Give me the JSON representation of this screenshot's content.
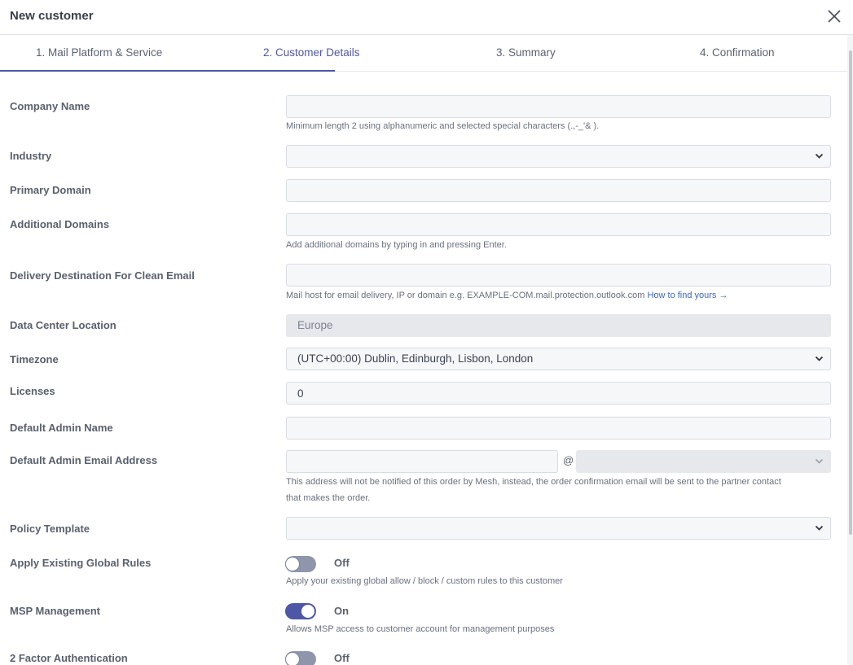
{
  "dialog": {
    "title": "New customer",
    "close_icon": "close-icon"
  },
  "tabs": [
    {
      "label": "1. Mail Platform & Service",
      "active": false
    },
    {
      "label": "2. Customer Details",
      "active": true
    },
    {
      "label": "3. Summary",
      "active": false
    },
    {
      "label": "4. Confirmation",
      "active": false
    }
  ],
  "form": {
    "company_name": {
      "label": "Company Name",
      "value": "",
      "help": "Minimum length 2 using alphanumeric and selected special characters (.,-_'& )."
    },
    "industry": {
      "label": "Industry",
      "value": ""
    },
    "primary_domain": {
      "label": "Primary Domain",
      "value": ""
    },
    "additional_domains": {
      "label": "Additional Domains",
      "value": "",
      "help": "Add additional domains by typing in and pressing Enter."
    },
    "delivery_destination": {
      "label": "Delivery Destination For Clean Email",
      "value": "",
      "help": "Mail host for email delivery, IP or domain e.g. EXAMPLE-COM.mail.protection.outlook.com",
      "help_link": "How to find yours →"
    },
    "data_center_location": {
      "label": "Data Center Location",
      "value": "Europe"
    },
    "timezone": {
      "label": "Timezone",
      "value": "(UTC+00:00) Dublin, Edinburgh, Lisbon, London"
    },
    "licenses": {
      "label": "Licenses",
      "value": "0"
    },
    "default_admin_name": {
      "label": "Default Admin Name",
      "value": ""
    },
    "default_admin_email": {
      "label": "Default Admin Email Address",
      "local_value": "",
      "at": "@",
      "domain_value": "",
      "help_line1": "This address will not be notified of this order by Mesh, instead, the order confirmation email will be sent to the partner contact",
      "help_line2": "that makes the order."
    },
    "policy_template": {
      "label": "Policy Template",
      "value": ""
    },
    "apply_global_rules": {
      "label": "Apply Existing Global Rules",
      "state": "Off",
      "help": "Apply your existing global allow / block / custom rules to this customer"
    },
    "msp_management": {
      "label": "MSP Management",
      "state": "On",
      "help": "Allows MSP access to customer account for management purposes"
    },
    "two_factor": {
      "label": "2 Factor Authentication",
      "state": "Off"
    }
  },
  "colors": {
    "accent": "#4e57a6",
    "link": "#3d67b7",
    "toggle_off": "#8f96ac"
  }
}
